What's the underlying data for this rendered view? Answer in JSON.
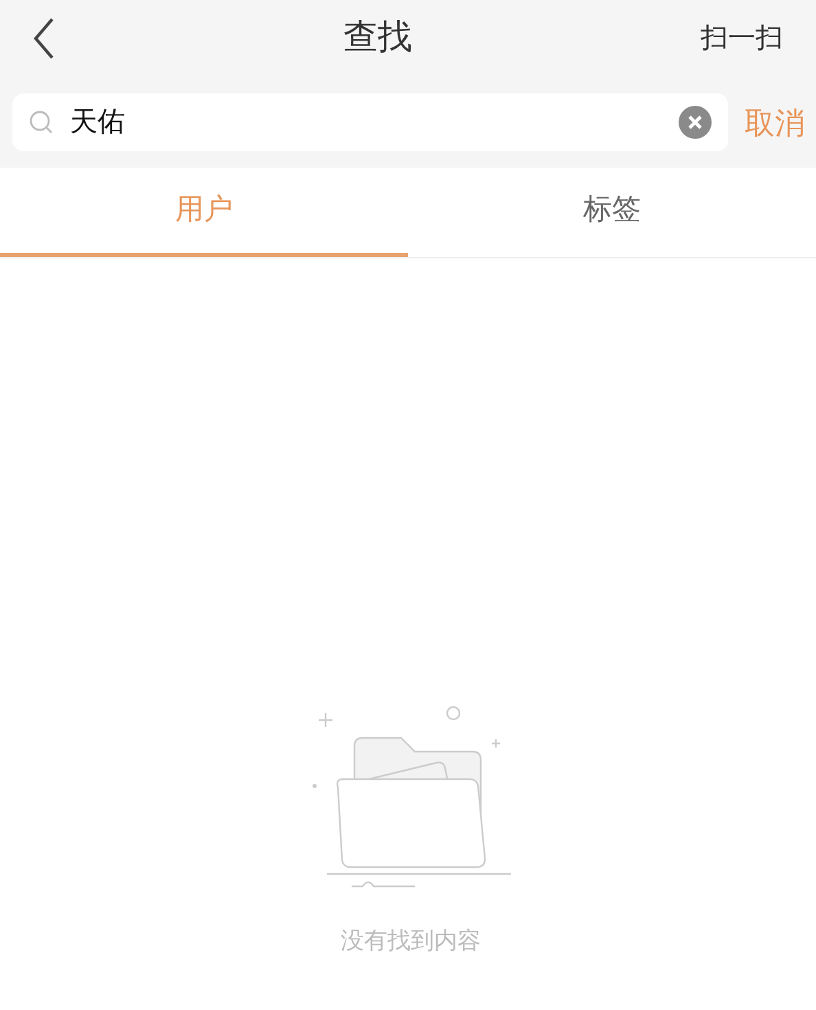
{
  "header": {
    "title": "查找",
    "action": "扫一扫"
  },
  "search": {
    "value": "天佑",
    "cancel": "取消"
  },
  "tabs": [
    {
      "label": "用户",
      "selected": true
    },
    {
      "label": "标签",
      "selected": false
    }
  ],
  "empty_state": {
    "message": "没有找到内容"
  }
}
